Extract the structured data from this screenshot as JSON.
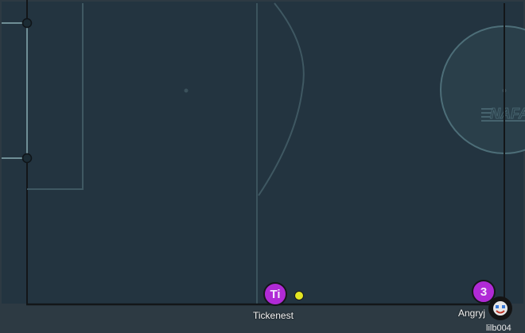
{
  "colors": {
    "background": "#2d3a43",
    "pitch": "#243540",
    "line_bright": "#1a1d20",
    "line_faint": "#3d5560",
    "home_team": "#b02ad6",
    "ball": "#e3e622"
  },
  "players": [
    {
      "id": "tickenest",
      "avatar_text": "Ti",
      "name": "Tickenest",
      "color": "#b02ad6"
    },
    {
      "id": "angryj",
      "avatar_text": "3",
      "name": "Angryj",
      "color": "#b02ad6"
    }
  ],
  "watermark": "NAFA",
  "partial_label": "lilb004",
  "avatar_icon": "face-icon"
}
